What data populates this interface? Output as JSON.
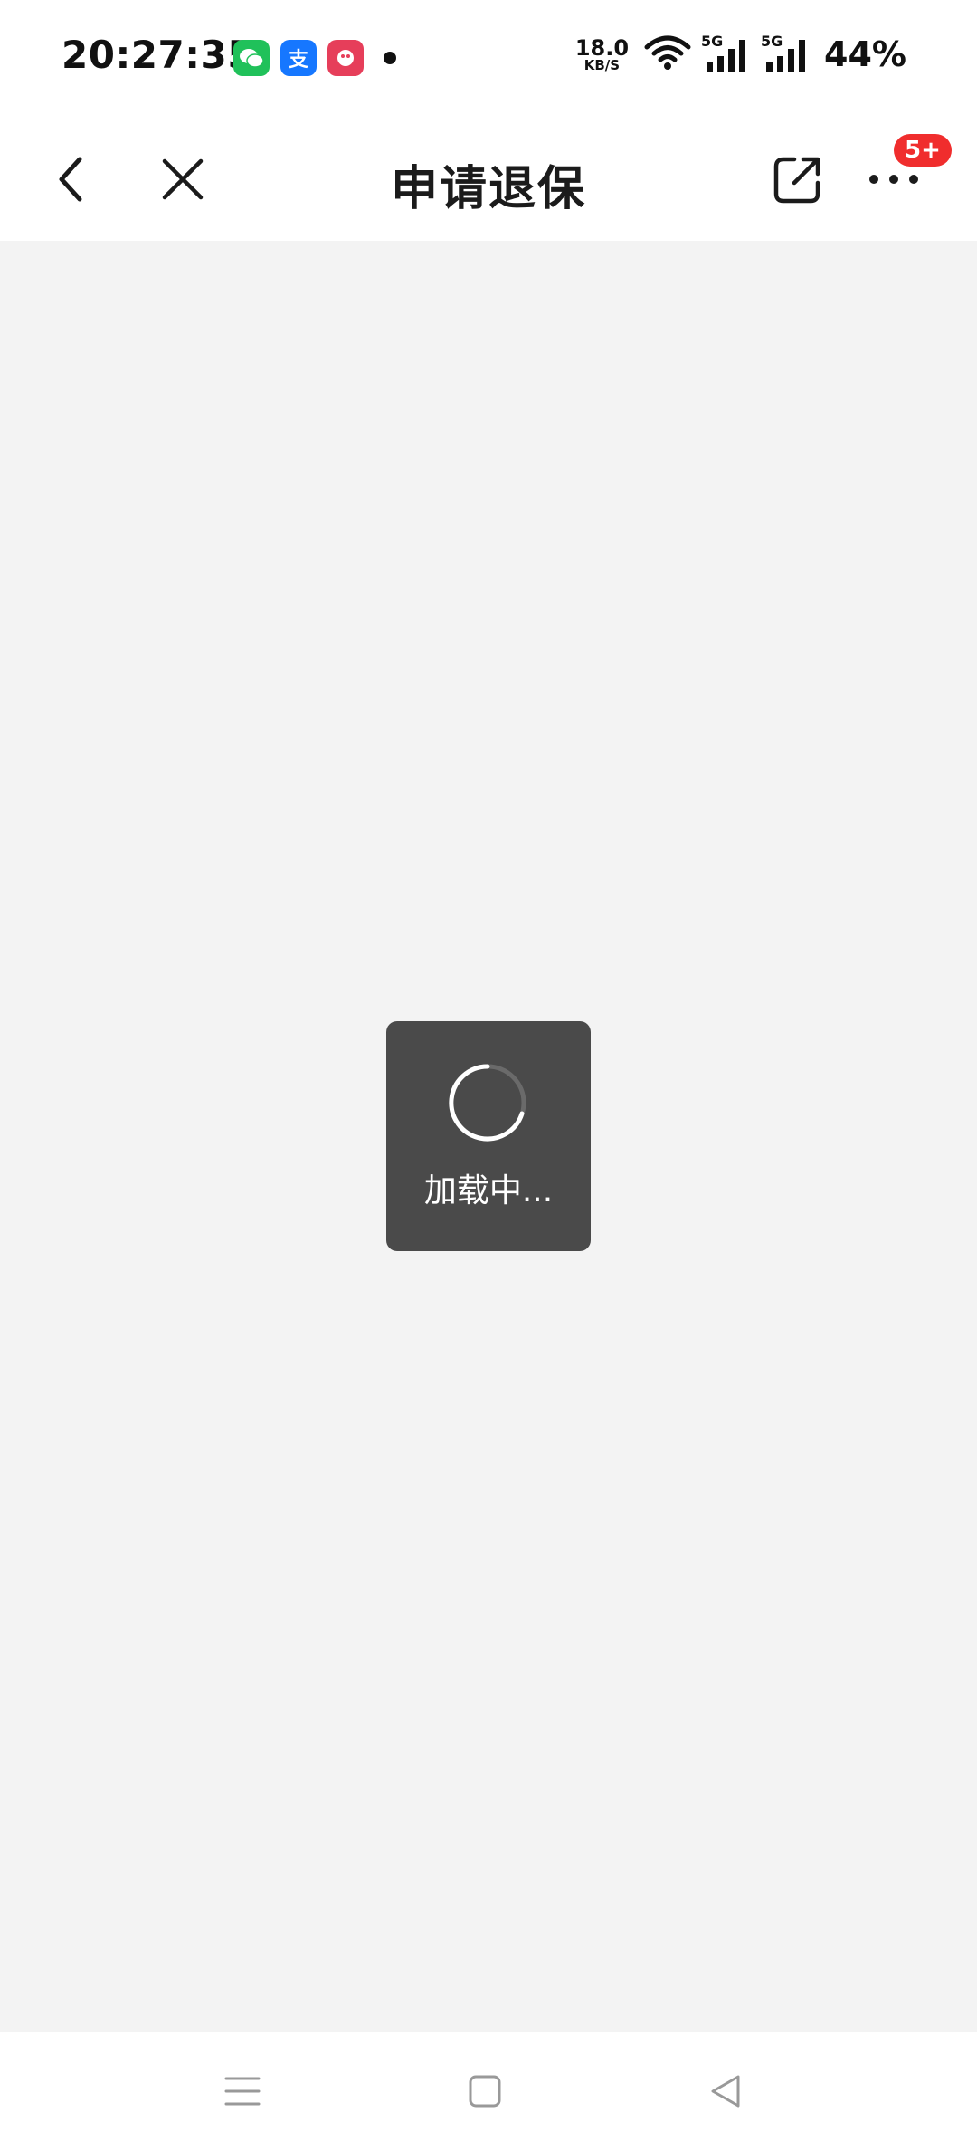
{
  "status_bar": {
    "time": "20:27:35",
    "notification_apps": [
      "wechat-icon",
      "alipay-icon",
      "shopping-app-icon"
    ],
    "alipay_glyph": "支",
    "net_speed_value": "18.0",
    "net_speed_unit": "KB/S",
    "network_labels": [
      "5G",
      "5G"
    ],
    "battery": "44%"
  },
  "nav_bar": {
    "title": "申请退保",
    "more_badge": "5+"
  },
  "loading": {
    "text": "加载中..."
  },
  "colors": {
    "background": "#f3f3f3",
    "badge": "#f02d2d",
    "loading_box": "#4a4a4a"
  }
}
